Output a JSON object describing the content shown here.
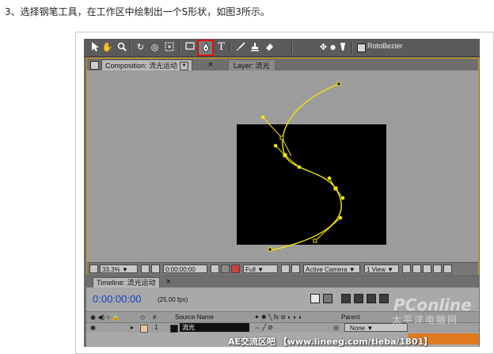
{
  "caption": "3、选择钢笔工具，在工作区中绘制出一个S形状，如图3所示。",
  "toolbar": {
    "tools": [
      "selection-tool",
      "hand-tool",
      "zoom-tool",
      "rotation-tool",
      "orbit-camera-tool",
      "pan-behind-tool",
      "rectangle-mask-tool",
      "pen-tool",
      "type-tool",
      "brush-tool",
      "clone-stamp-tool",
      "eraser-tool",
      "puppet-tool"
    ],
    "selected_tool": "pen-tool",
    "rotobezier_label": "RotoBezier",
    "rotobezier_checked": false,
    "highlight_color": "#e01010"
  },
  "composition_panel": {
    "comp_tab_label": "Composition: 流光运动",
    "close_glyph": "×",
    "layer_tab_label": "Layer: 流光",
    "panel_border_color": "#d9a400",
    "path_color": "#f2e600"
  },
  "viewer_footer": {
    "zoom": "33.3%",
    "timecode": "0:00:00:00",
    "resolution": "Full",
    "camera": "Active Camera",
    "view": "1 View"
  },
  "timeline": {
    "tab_label": "Timeline: 流光运动",
    "close_glyph": "×",
    "current_time": "0:00:00:00",
    "fps": "(25.00 fps)",
    "columns": {
      "source_name": "Source Name",
      "parent": "Parent"
    },
    "layers": [
      {
        "index": "1",
        "name": "流光",
        "parent": "None"
      }
    ]
  },
  "watermarks": {
    "brand": "PConline",
    "brand_cn": "太平洋电脑网",
    "footer": "AE交流区吧 【www.lineeg.com/tieba/1801】"
  }
}
